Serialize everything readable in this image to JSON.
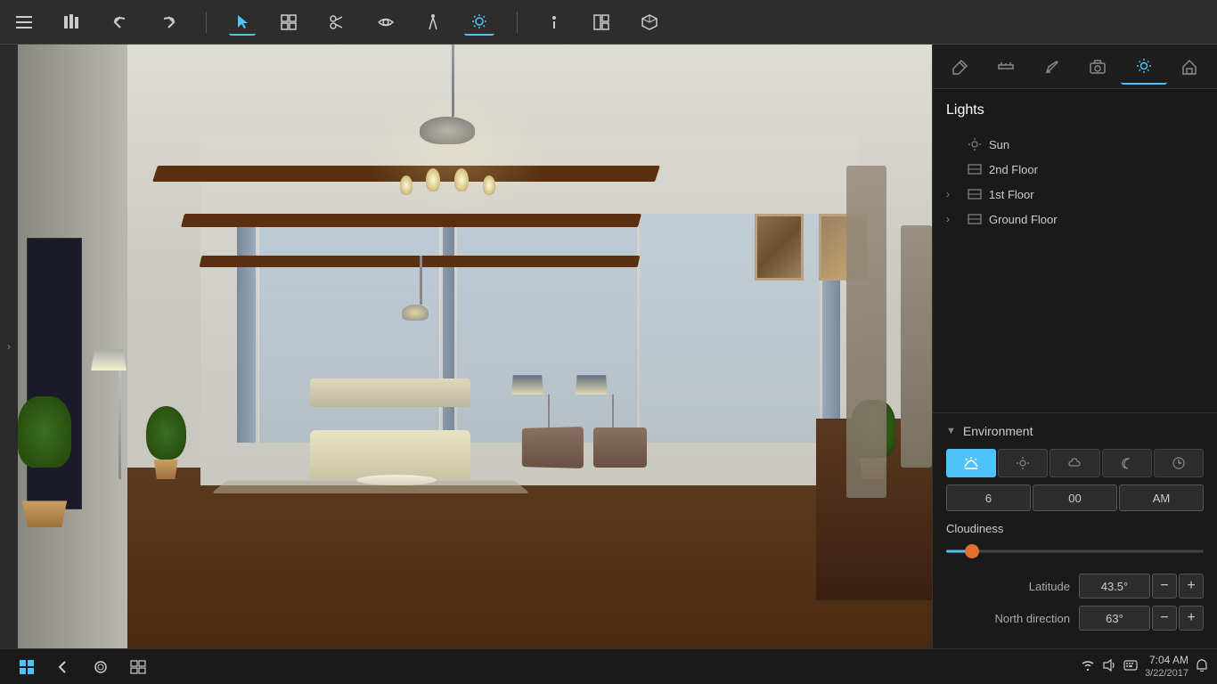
{
  "topToolbar": {
    "icons": [
      {
        "name": "hamburger-menu",
        "symbol": "☰",
        "active": false
      },
      {
        "name": "library",
        "symbol": "📚",
        "active": false
      },
      {
        "name": "undo",
        "symbol": "↩",
        "active": false
      },
      {
        "name": "redo",
        "symbol": "↪",
        "active": false
      },
      {
        "name": "select-tool",
        "symbol": "⬆",
        "active": true
      },
      {
        "name": "objects-tool",
        "symbol": "⊞",
        "active": false
      },
      {
        "name": "scissors-tool",
        "symbol": "✂",
        "active": false
      },
      {
        "name": "eye-tool",
        "symbol": "👁",
        "active": false
      },
      {
        "name": "walk-tool",
        "symbol": "🚶",
        "active": false
      },
      {
        "name": "sun-tool",
        "symbol": "☀",
        "active": true
      },
      {
        "name": "info-tool",
        "symbol": "ℹ",
        "active": false
      },
      {
        "name": "layout-tool",
        "symbol": "⊟",
        "active": false
      },
      {
        "name": "cube-tool",
        "symbol": "⬡",
        "active": false
      }
    ]
  },
  "rightPanel": {
    "icons": [
      {
        "name": "paint-bucket-icon",
        "symbol": "🪣",
        "active": false
      },
      {
        "name": "ruler-icon",
        "symbol": "📐",
        "active": false
      },
      {
        "name": "pencil-icon",
        "symbol": "✏",
        "active": false
      },
      {
        "name": "camera-icon",
        "symbol": "📷",
        "active": false
      },
      {
        "name": "sun-settings-icon",
        "symbol": "☀",
        "active": true
      },
      {
        "name": "house-icon",
        "symbol": "🏠",
        "active": false
      }
    ],
    "lightsTitle": "Lights",
    "lightItems": [
      {
        "id": "sun",
        "label": "Sun",
        "icon": "☀",
        "expand": "",
        "indent": false
      },
      {
        "id": "2nd-floor",
        "label": "2nd Floor",
        "icon": "⊟",
        "expand": "",
        "indent": false
      },
      {
        "id": "1st-floor",
        "label": "1st Floor",
        "icon": "⊟",
        "expand": "›",
        "indent": false
      },
      {
        "id": "ground-floor",
        "label": "Ground Floor",
        "icon": "⊟",
        "expand": "›",
        "indent": false
      }
    ],
    "environment": {
      "title": "Environment",
      "timeIcons": [
        {
          "name": "sunrise-icon",
          "symbol": "🌅",
          "active": true
        },
        {
          "name": "sun-icon",
          "symbol": "☀",
          "active": false
        },
        {
          "name": "cloud-icon",
          "symbol": "☁",
          "active": false
        },
        {
          "name": "moon-icon",
          "symbol": "☾",
          "active": false
        },
        {
          "name": "clock-icon",
          "symbol": "⏱",
          "active": false
        }
      ],
      "timeHour": "6",
      "timeMinute": "00",
      "timeAmPm": "AM",
      "cloudinessLabel": "Cloudiness",
      "cloudinessValue": 10,
      "latitudeLabel": "Latitude",
      "latitudeValue": "43.5°",
      "northDirectionLabel": "North direction",
      "northDirectionValue": "63°"
    }
  },
  "taskbar": {
    "startLabel": "Start",
    "buttons": [
      {
        "name": "back-button",
        "symbol": "←"
      },
      {
        "name": "cortana-button",
        "symbol": "○"
      },
      {
        "name": "task-view-button",
        "symbol": "⧉"
      }
    ],
    "tray": {
      "network-icon": "🌐",
      "volume-icon": "🔊",
      "keyboard-icon": "⌨"
    },
    "clock": {
      "time": "7:04 AM",
      "date": "3/22/2017"
    },
    "notification-icon": "🔔"
  }
}
